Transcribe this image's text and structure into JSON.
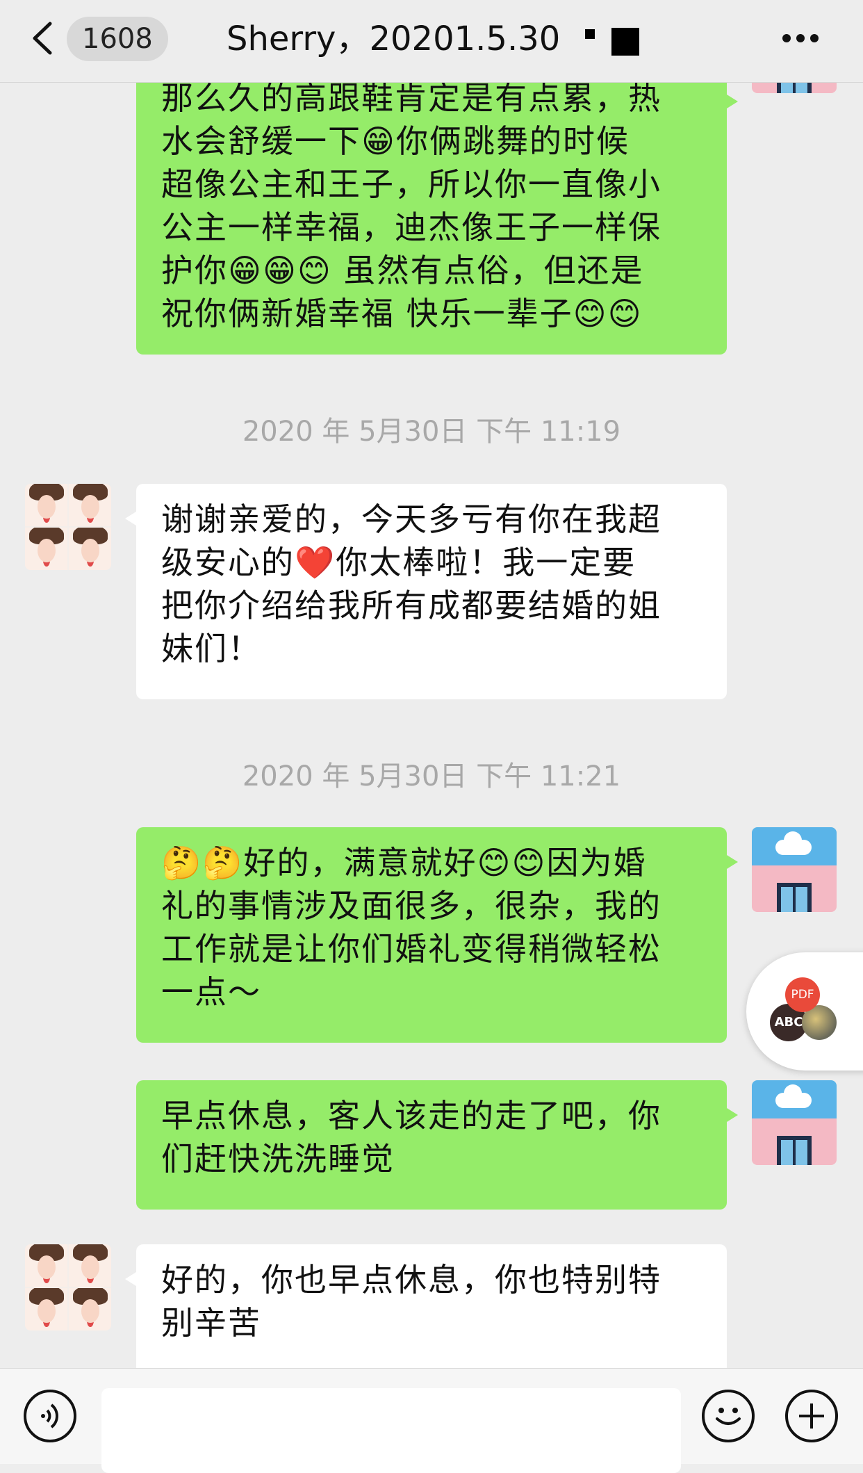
{
  "header": {
    "unread_count": "1608",
    "title": "Sherry，20201.5.30"
  },
  "messages": [
    {
      "sender": "me",
      "text": "那么久的高跟鞋肯定是有点累，热\n水会舒缓一下😁你俩跳舞的时候\n超像公主和王子，所以你一直像小\n公主一样幸福，迪杰像王子一样保\n护你😁😁😊 虽然有点俗，但还是\n祝你俩新婚幸福 快乐一辈子😊😊"
    },
    {
      "type": "timestamp",
      "text": "2020 年 5月30日 下午 11:19"
    },
    {
      "sender": "them",
      "text": "谢谢亲爱的，今天多亏有你在我超\n级安心的❤️你太棒啦！我一定要\n把你介绍给我所有成都要结婚的姐\n妹们！"
    },
    {
      "type": "timestamp",
      "text": "2020 年 5月30日 下午 11:21"
    },
    {
      "sender": "me",
      "text": "🤔🤔好的，满意就好😊😊因为婚\n礼的事情涉及面很多，很杂，我的\n工作就是让你们婚礼变得稍微轻松\n一点～"
    },
    {
      "sender": "me",
      "text": "早点休息，客人该走的走了吧，你\n们赶快洗洗睡觉"
    },
    {
      "sender": "them",
      "text": "好的，你也早点休息，你也特别特\n别辛苦"
    }
  ],
  "floating_widget": {
    "pdf_label": "PDF",
    "abc_label": "ABC"
  },
  "input_bar": {
    "voice_icon": "voice-icon",
    "emoji_icon": "emoji-icon",
    "plus_icon": "plus-icon"
  }
}
